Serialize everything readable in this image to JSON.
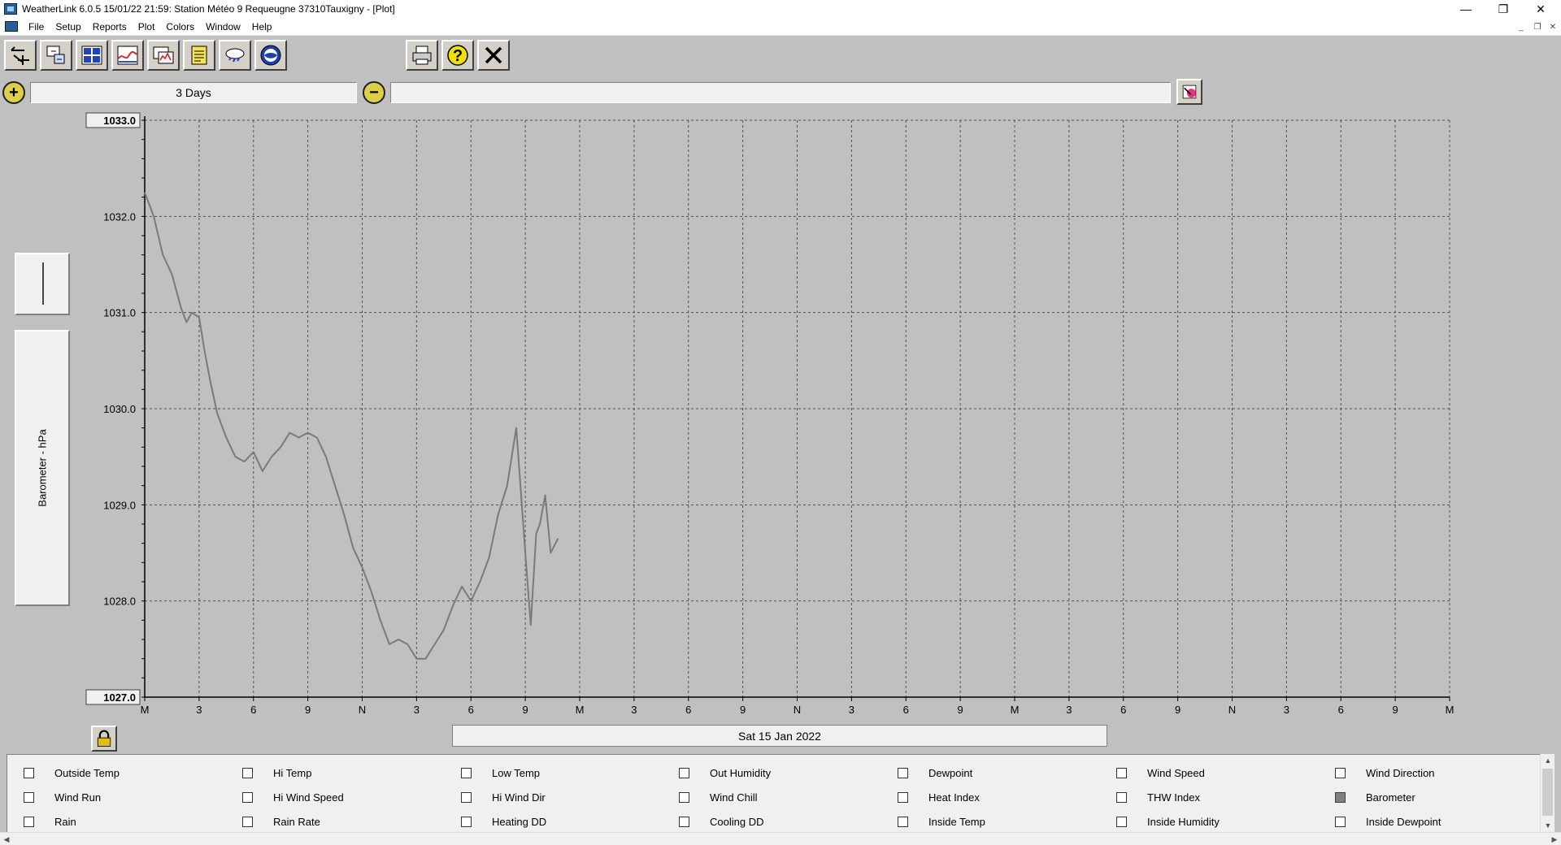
{
  "window": {
    "title": "WeatherLink 6.0.5  15/01/22  21:59: Station Météo 9 Requeugne 37310Tauxigny  - [Plot]",
    "minimize": "—",
    "restore": "❐",
    "close": "✕"
  },
  "menu": {
    "items": [
      "File",
      "Setup",
      "Reports",
      "Plot",
      "Colors",
      "Window",
      "Help"
    ]
  },
  "toolbar": {
    "icons": [
      "select-station-icon",
      "download-icon",
      "bulletin-icon",
      "summary-icon",
      "browse-icon",
      "notepad-icon",
      "weather-cloud-icon",
      "noaa-icon",
      "print-icon",
      "help-icon",
      "close-icon"
    ]
  },
  "zoom": {
    "plus": "+",
    "minus": "−",
    "span_label": "3 Days"
  },
  "side": {
    "axis_label": "Barometer - hPa"
  },
  "chart_data": {
    "type": "line",
    "title": "",
    "xlabel": "",
    "ylabel": "Barometer - hPa",
    "ylim": [
      1027.0,
      1033.0
    ],
    "y_ticks": [
      "1033.0",
      "1032.0",
      "1031.0",
      "1030.0",
      "1029.0",
      "1028.0",
      "1027.0"
    ],
    "x_range_hours": [
      0,
      72
    ],
    "x_tick_labels": [
      "M",
      "3",
      "6",
      "9",
      "N",
      "3",
      "6",
      "9",
      "M",
      "3",
      "6",
      "9",
      "N",
      "3",
      "6",
      "9",
      "M",
      "3",
      "6",
      "9",
      "N",
      "3",
      "6",
      "9",
      "M"
    ],
    "grid": true,
    "series": [
      {
        "x": [
          0,
          0.5,
          1.0,
          1.5,
          2.0,
          2.3,
          2.6,
          3.0,
          3.3,
          3.6,
          4.0,
          4.5,
          5.0,
          5.5,
          6.0,
          6.5,
          7.0,
          7.5,
          8.0,
          8.5,
          9.0,
          9.5,
          10.0,
          10.5,
          11.0,
          11.5,
          12.0,
          12.5,
          13.0,
          13.5,
          14.0,
          14.5,
          15.0,
          15.5,
          16.0,
          16.5,
          17.0,
          17.5,
          18.0,
          18.5,
          19.0,
          19.5,
          20.0,
          20.5,
          21.0,
          21.3,
          21.6,
          21.8,
          22.1,
          22.4,
          22.8
        ],
        "y": [
          1032.25,
          1032.0,
          1031.6,
          1031.4,
          1031.05,
          1030.9,
          1031.0,
          1030.95,
          1030.6,
          1030.3,
          1029.95,
          1029.7,
          1029.5,
          1029.45,
          1029.55,
          1029.35,
          1029.5,
          1029.6,
          1029.75,
          1029.7,
          1029.75,
          1029.7,
          1029.5,
          1029.2,
          1028.9,
          1028.55,
          1028.35,
          1028.1,
          1027.8,
          1027.55,
          1027.6,
          1027.55,
          1027.4,
          1027.4,
          1027.55,
          1027.7,
          1027.95,
          1028.15,
          1028.0,
          1028.2,
          1028.45,
          1028.9,
          1029.2,
          1029.8,
          1028.5,
          1027.75,
          1028.7,
          1028.8,
          1029.1,
          1028.5,
          1028.65
        ]
      }
    ],
    "date_label": "Sat 15 Jan 2022",
    "colors": {
      "line": "#7a7a7a",
      "grid": "#505050",
      "background": "#c0c0c0"
    }
  },
  "checkboxes": [
    {
      "label": "Outside Temp",
      "checked": false
    },
    {
      "label": "Hi Temp",
      "checked": false
    },
    {
      "label": "Low Temp",
      "checked": false
    },
    {
      "label": "Out Humidity",
      "checked": false
    },
    {
      "label": "Dewpoint",
      "checked": false
    },
    {
      "label": "Wind Speed",
      "checked": false
    },
    {
      "label": "Wind Direction",
      "checked": false
    },
    {
      "label": "Wind Run",
      "checked": false
    },
    {
      "label": "Hi Wind Speed",
      "checked": false
    },
    {
      "label": "Hi Wind Dir",
      "checked": false
    },
    {
      "label": "Wind Chill",
      "checked": false
    },
    {
      "label": "Heat Index",
      "checked": false
    },
    {
      "label": "THW Index",
      "checked": false
    },
    {
      "label": "Barometer",
      "checked": true
    },
    {
      "label": "Rain",
      "checked": false
    },
    {
      "label": "Rain Rate",
      "checked": false
    },
    {
      "label": "Heating DD",
      "checked": false
    },
    {
      "label": "Cooling DD",
      "checked": false
    },
    {
      "label": "Inside Temp",
      "checked": false
    },
    {
      "label": "Inside Humidity",
      "checked": false
    },
    {
      "label": "Inside Dewpoint",
      "checked": false
    }
  ],
  "scroll": {
    "up": "▲",
    "down": "▼",
    "left": "◀",
    "right": "▶"
  }
}
